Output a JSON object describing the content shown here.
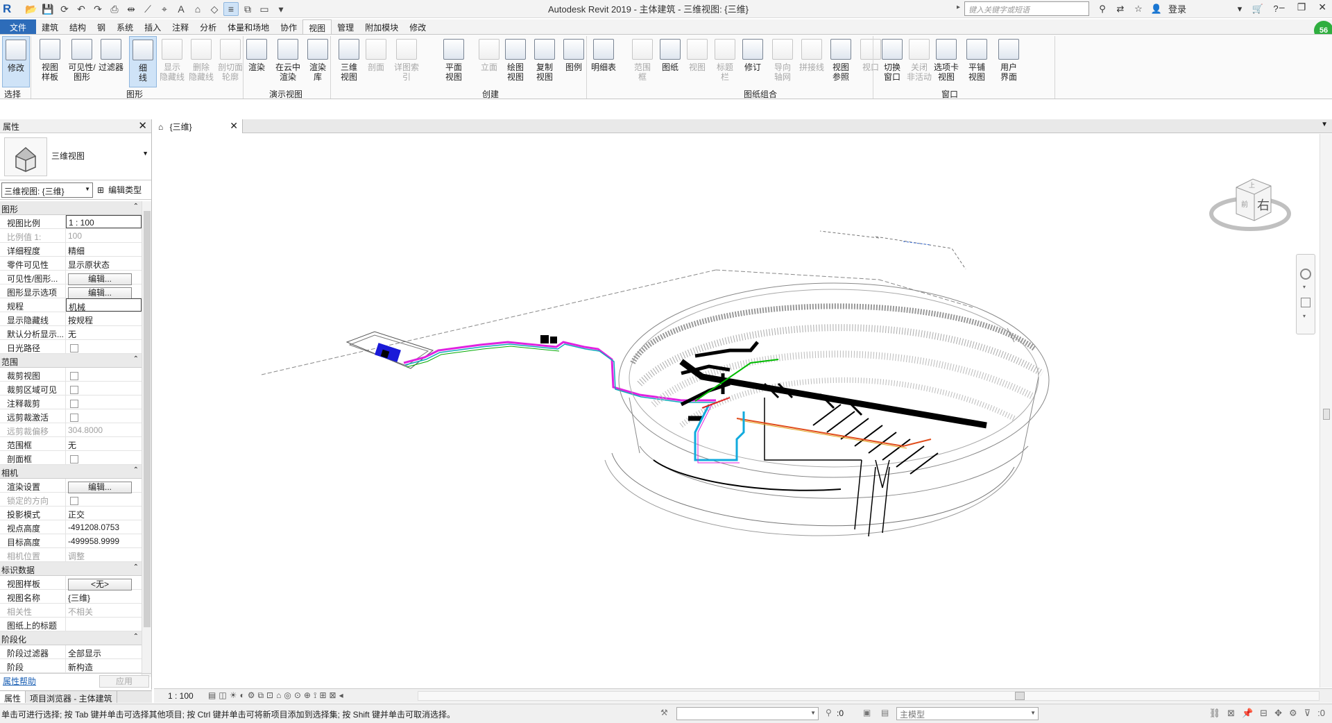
{
  "titlebar": {
    "app_title": "Autodesk Revit 2019 - 主体建筑 - 三维视图: {三维}",
    "search_placeholder": "键入关键字或短语",
    "login": "登录",
    "badge": "56"
  },
  "ribbon_tabs": [
    "文件",
    "建筑",
    "结构",
    "钢",
    "系统",
    "插入",
    "注释",
    "分析",
    "体量和场地",
    "协作",
    "视图",
    "管理",
    "附加模块",
    "修改"
  ],
  "active_tab": "视图",
  "ribbon": {
    "buttons": [
      {
        "id": "modify",
        "label": "修改",
        "enabled": true,
        "selected": true
      },
      {
        "id": "view-template",
        "label": "视图\n样板",
        "enabled": true
      },
      {
        "id": "visibility",
        "label": "可见性/\n图形",
        "enabled": true
      },
      {
        "id": "filters",
        "label": "过滤器",
        "enabled": true
      },
      {
        "id": "thin-lines",
        "label": "细\n线",
        "enabled": true,
        "selected": true
      },
      {
        "id": "show-hidden",
        "label": "显示\n隐藏线",
        "enabled": false
      },
      {
        "id": "remove-hidden",
        "label": "删除\n隐藏线",
        "enabled": false
      },
      {
        "id": "cut-profile",
        "label": "剖切面\n轮廓",
        "enabled": false
      },
      {
        "id": "render",
        "label": "渲染",
        "enabled": true
      },
      {
        "id": "cloud-render",
        "label": "在云中\n渲染",
        "enabled": true
      },
      {
        "id": "render-gallery",
        "label": "渲染\n库",
        "enabled": true
      },
      {
        "id": "3d-view",
        "label": "三维\n视图",
        "enabled": true
      },
      {
        "id": "section",
        "label": "剖面",
        "enabled": false
      },
      {
        "id": "callout",
        "label": "详图索引",
        "enabled": false
      },
      {
        "id": "plan-views",
        "label": "平面\n视图",
        "enabled": true
      },
      {
        "id": "elevation",
        "label": "立面",
        "enabled": false
      },
      {
        "id": "drafting-view",
        "label": "绘图\n视图",
        "enabled": true
      },
      {
        "id": "duplicate-view",
        "label": "复制\n视图",
        "enabled": true
      },
      {
        "id": "legends",
        "label": "图例",
        "enabled": true
      },
      {
        "id": "schedules",
        "label": "明细表",
        "enabled": true
      },
      {
        "id": "scope-box",
        "label": "范围\n框",
        "enabled": false
      },
      {
        "id": "sheet",
        "label": "图纸",
        "enabled": true
      },
      {
        "id": "view",
        "label": "视图",
        "enabled": false
      },
      {
        "id": "title-block",
        "label": "标题\n栏",
        "enabled": false
      },
      {
        "id": "revisions",
        "label": "修订",
        "enabled": true
      },
      {
        "id": "guide-grid",
        "label": "导向\n轴网",
        "enabled": false
      },
      {
        "id": "matchline",
        "label": "拼接线",
        "enabled": false
      },
      {
        "id": "view-reference",
        "label": "视图\n参照",
        "enabled": true
      },
      {
        "id": "viewports",
        "label": "视口",
        "enabled": false
      },
      {
        "id": "switch-windows",
        "label": "切换\n窗口",
        "enabled": true
      },
      {
        "id": "close-inactive",
        "label": "关闭\n非活动",
        "enabled": false
      },
      {
        "id": "tab-views",
        "label": "选项卡\n视图",
        "enabled": true
      },
      {
        "id": "tile-views",
        "label": "平铺\n视图",
        "enabled": true
      },
      {
        "id": "user-interface",
        "label": "用户\n界面",
        "enabled": true
      }
    ],
    "groups": [
      "选择",
      "图形",
      "演示视图",
      "创建",
      "图纸组合",
      "窗口"
    ]
  },
  "properties": {
    "title": "属性",
    "type_name": "三维视图",
    "instance_combo": "三维视图: {三维}",
    "edit_type": "编辑类型",
    "help": "属性帮助",
    "apply": "应用",
    "sections": [
      {
        "name": "图形",
        "rows": [
          {
            "k": "视图比例",
            "v": "1 : 100",
            "t": "boxed"
          },
          {
            "k": "比例值 1:",
            "v": "100",
            "t": "dim"
          },
          {
            "k": "详细程度",
            "v": "精细"
          },
          {
            "k": "零件可见性",
            "v": "显示原状态"
          },
          {
            "k": "可见性/图形...",
            "v": "编辑...",
            "t": "btn"
          },
          {
            "k": "图形显示选项",
            "v": "编辑...",
            "t": "btn"
          },
          {
            "k": "规程",
            "v": "机械",
            "t": "boxed"
          },
          {
            "k": "显示隐藏线",
            "v": "按规程"
          },
          {
            "k": "默认分析显示...",
            "v": "无"
          },
          {
            "k": "日光路径",
            "v": "",
            "t": "chk"
          }
        ]
      },
      {
        "name": "范围",
        "rows": [
          {
            "k": "裁剪视图",
            "v": "",
            "t": "chk"
          },
          {
            "k": "裁剪区域可见",
            "v": "",
            "t": "chk"
          },
          {
            "k": "注释裁剪",
            "v": "",
            "t": "chk"
          },
          {
            "k": "远剪裁激活",
            "v": "",
            "t": "chk"
          },
          {
            "k": "远剪裁偏移",
            "v": "304.8000",
            "t": "dim"
          },
          {
            "k": "范围框",
            "v": "无"
          },
          {
            "k": "剖面框",
            "v": "",
            "t": "chk"
          }
        ]
      },
      {
        "name": "相机",
        "rows": [
          {
            "k": "渲染设置",
            "v": "编辑...",
            "t": "btn"
          },
          {
            "k": "锁定的方向",
            "v": "",
            "t": "chkdim"
          },
          {
            "k": "投影模式",
            "v": "正交"
          },
          {
            "k": "视点高度",
            "v": "-491208.0753"
          },
          {
            "k": "目标高度",
            "v": "-499958.9999"
          },
          {
            "k": "相机位置",
            "v": "调整",
            "t": "dim"
          }
        ]
      },
      {
        "name": "标识数据",
        "rows": [
          {
            "k": "视图样板",
            "v": "<无>",
            "t": "btn"
          },
          {
            "k": "视图名称",
            "v": "{三维}"
          },
          {
            "k": "相关性",
            "v": "不相关",
            "t": "dim"
          },
          {
            "k": "图纸上的标题",
            "v": ""
          }
        ]
      },
      {
        "name": "阶段化",
        "rows": [
          {
            "k": "阶段过滤器",
            "v": "全部显示"
          },
          {
            "k": "阶段",
            "v": "新构造"
          }
        ]
      }
    ]
  },
  "panel_tabs": [
    "属性",
    "项目浏览器 - 主体建筑"
  ],
  "view_tab": {
    "label": "{三维}"
  },
  "view_control": {
    "scale": "1 : 100"
  },
  "viewcube": {
    "face": "右",
    "face_top": "上",
    "face_front": "前"
  },
  "statusbar": {
    "message": "单击可进行选择; 按 Tab 键并单击可选择其他项目; 按 Ctrl 键并单击可将新项目添加到选择集; 按 Shift 键并单击可取消选择。",
    "count1": ":0",
    "model": "主模型",
    "filter_count": ":0"
  }
}
